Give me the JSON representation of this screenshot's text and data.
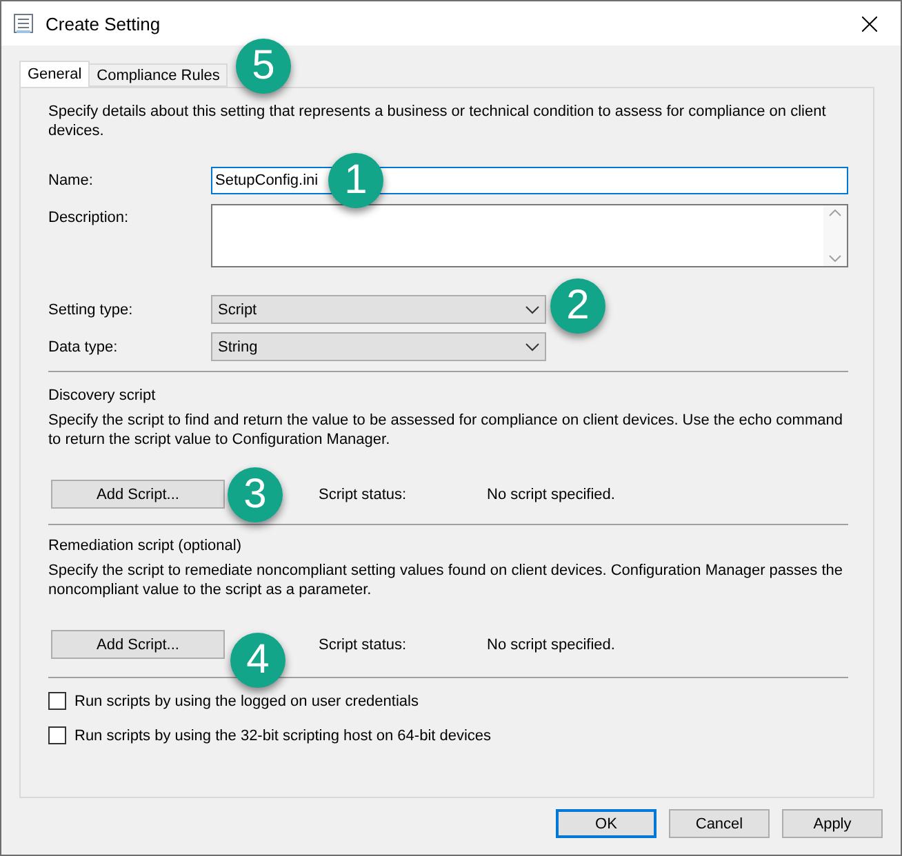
{
  "window": {
    "title": "Create Setting"
  },
  "tabs": [
    {
      "label": "General",
      "selected": true
    },
    {
      "label": "Compliance Rules",
      "selected": false
    }
  ],
  "intro": "Specify details about this setting that represents a business or technical condition to assess for compliance on client devices.",
  "fields": [
    {
      "label": "Name:",
      "value": "SetupConfig.ini"
    },
    {
      "label": "Description:"
    }
  ],
  "dropdowns": [
    {
      "label": "Setting type:",
      "value": "Script"
    },
    {
      "label": "Data type:",
      "value": "String"
    }
  ],
  "scripts": [
    {
      "heading": "Discovery script",
      "text": "Specify the script to find and return the value to be assessed for compliance on client devices. Use the echo command to return the script value to Configuration Manager.",
      "button": "Add Script...",
      "status_label": "Script status:",
      "status": "No script specified."
    },
    {
      "heading": "Remediation script (optional)",
      "text": "Specify the script to remediate noncompliant setting values found on client devices. Configuration Manager passes the noncompliant value to the script as a parameter.",
      "button": "Add Script...",
      "status_label": "Script status:",
      "status": "No script specified."
    }
  ],
  "options": [
    {
      "label": "Run scripts by using the logged on user credentials",
      "checked": false
    },
    {
      "label": "Run scripts by using the 32-bit scripting host on 64-bit devices",
      "checked": false
    }
  ],
  "buttons": [
    {
      "label": "OK",
      "default": true
    },
    {
      "label": "Cancel",
      "default": false
    },
    {
      "label": "Apply",
      "default": false
    }
  ],
  "callouts": [
    {
      "number": "5"
    },
    {
      "number": "1"
    },
    {
      "number": "2"
    },
    {
      "number": "3"
    },
    {
      "number": "4"
    }
  ]
}
